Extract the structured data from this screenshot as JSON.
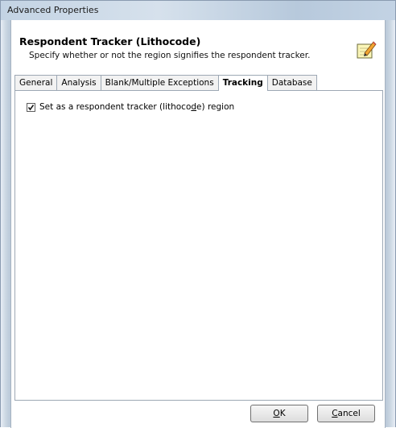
{
  "window": {
    "title": "Advanced Properties"
  },
  "header": {
    "title": "Respondent Tracker (Lithocode)",
    "subtitle": "Specify whether or not the region signifies the respondent tracker.",
    "icon": "edit-note-icon"
  },
  "tabs": [
    {
      "label": "General",
      "active": false
    },
    {
      "label": "Analysis",
      "active": false
    },
    {
      "label": "Blank/Multiple Exceptions",
      "active": false
    },
    {
      "label": "Tracking",
      "active": true
    },
    {
      "label": "Database",
      "active": false
    }
  ],
  "tracking": {
    "checkbox_checked": true,
    "checkbox_label_before": "Set as a respondent tracker (lithoco",
    "checkbox_label_mnemonic": "d",
    "checkbox_label_after": "e) region"
  },
  "buttons": {
    "ok_mnemonic": "O",
    "ok_rest": "K",
    "cancel_mnemonic": "C",
    "cancel_rest": "ancel"
  },
  "colors": {
    "frame": "#c9d8e6",
    "tab_border": "#9da8b4"
  }
}
